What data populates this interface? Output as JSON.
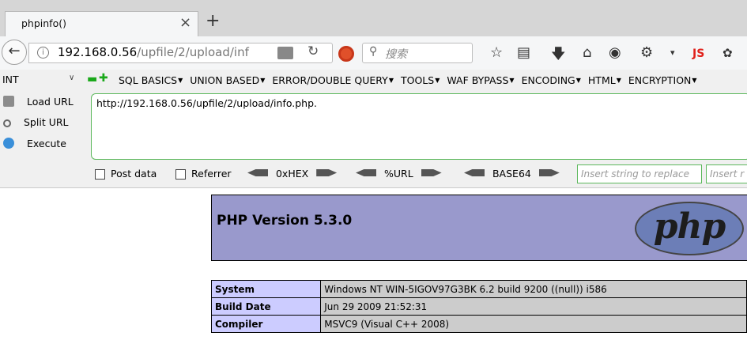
{
  "browser": {
    "tab_title": "phpinfo()",
    "tab_close": "×",
    "new_tab": "+",
    "url_host": "192.168.0.56",
    "url_path": "/upfile/2/upload/inf",
    "search_placeholder": "搜索",
    "icons": [
      "back-icon",
      "info-icon",
      "reader-icon",
      "reload-icon",
      "block-icon",
      "search-icon",
      "star-icon",
      "library-icon",
      "download-icon",
      "home-icon",
      "globe-icon",
      "palette-icon",
      "js-icon",
      "bug-icon"
    ],
    "js_label": "JS"
  },
  "hackbar": {
    "select_value": "INT",
    "menu": [
      "SQL BASICS",
      "UNION BASED",
      "ERROR/DOUBLE QUERY",
      "TOOLS",
      "WAF BYPASS",
      "ENCODING",
      "HTML",
      "ENCRYPTION"
    ],
    "load_url": "Load URL",
    "split_url": "Split URL",
    "execute": "Execute",
    "url_value": "http://192.168.0.56/upfile/2/upload/info.php.",
    "post_data": "Post data",
    "referrer": "Referrer",
    "hex": "0xHEX",
    "urlenc": "%URL",
    "base64": "BASE64",
    "replace_ph": "Insert string to replace",
    "replace_with_ph": "Insert r"
  },
  "phpinfo": {
    "version_title": "PHP Version 5.3.0",
    "logo_text": "php",
    "rows": [
      {
        "key": "System",
        "value": "Windows NT WIN-5IGOV97G3BK 6.2 build 9200 ((null)) i586"
      },
      {
        "key": "Build Date",
        "value": "Jun 29 2009 21:52:31"
      },
      {
        "key": "Compiler",
        "value": "MSVC9 (Visual C++ 2008)"
      }
    ]
  },
  "colors": {
    "php_header": "#9999cc",
    "table_key": "#ccccff",
    "table_value": "#cccccc",
    "hackbar_border": "#5cb85c"
  }
}
